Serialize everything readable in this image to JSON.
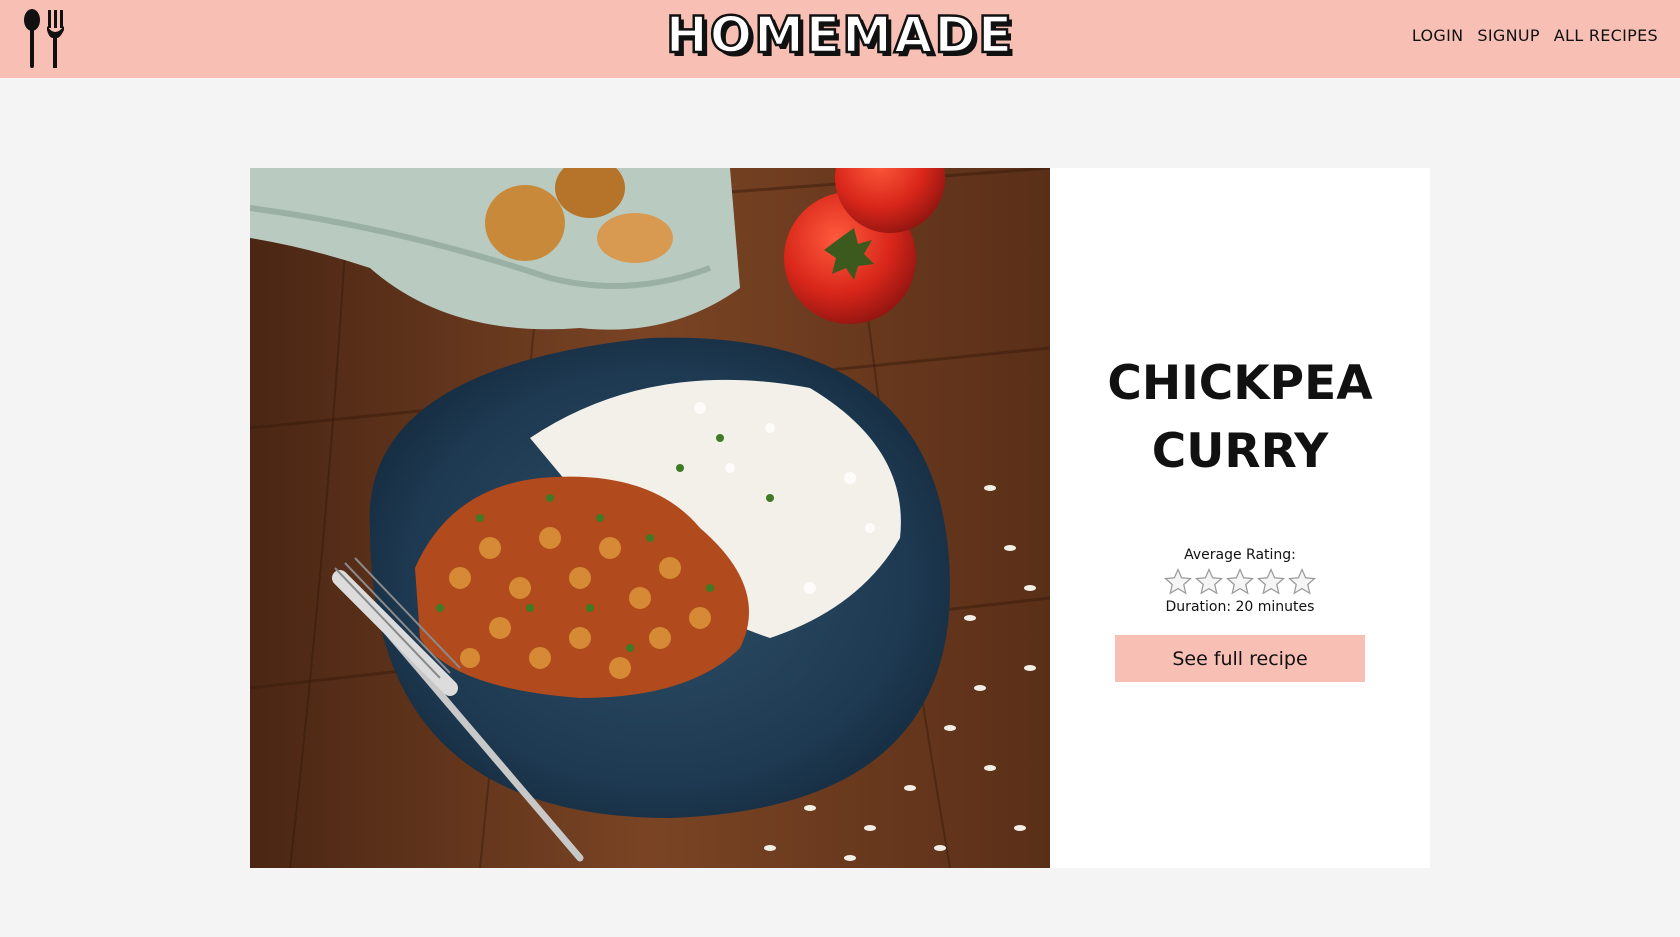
{
  "header": {
    "brand": "HOMEMADE",
    "logo_icon": "spoon-fork-icon",
    "nav": [
      {
        "label": "LOGIN"
      },
      {
        "label": "SIGNUP"
      },
      {
        "label": "ALL RECIPES"
      }
    ],
    "background_color": "#f8c0b5"
  },
  "recipe": {
    "title": "CHICKPEA CURRY",
    "rating_label": "Average Rating:",
    "rating_value": 0,
    "rating_max": 5,
    "duration_text": "Duration: 20 minutes",
    "button_label": "See full recipe",
    "image": "photo of chickpea curry with white rice on a blue plate, fork, tomatoes and onions on a wooden table"
  },
  "colors": {
    "accent": "#f8c0b5",
    "page_background": "#f4f4f4",
    "card_background": "#ffffff"
  }
}
